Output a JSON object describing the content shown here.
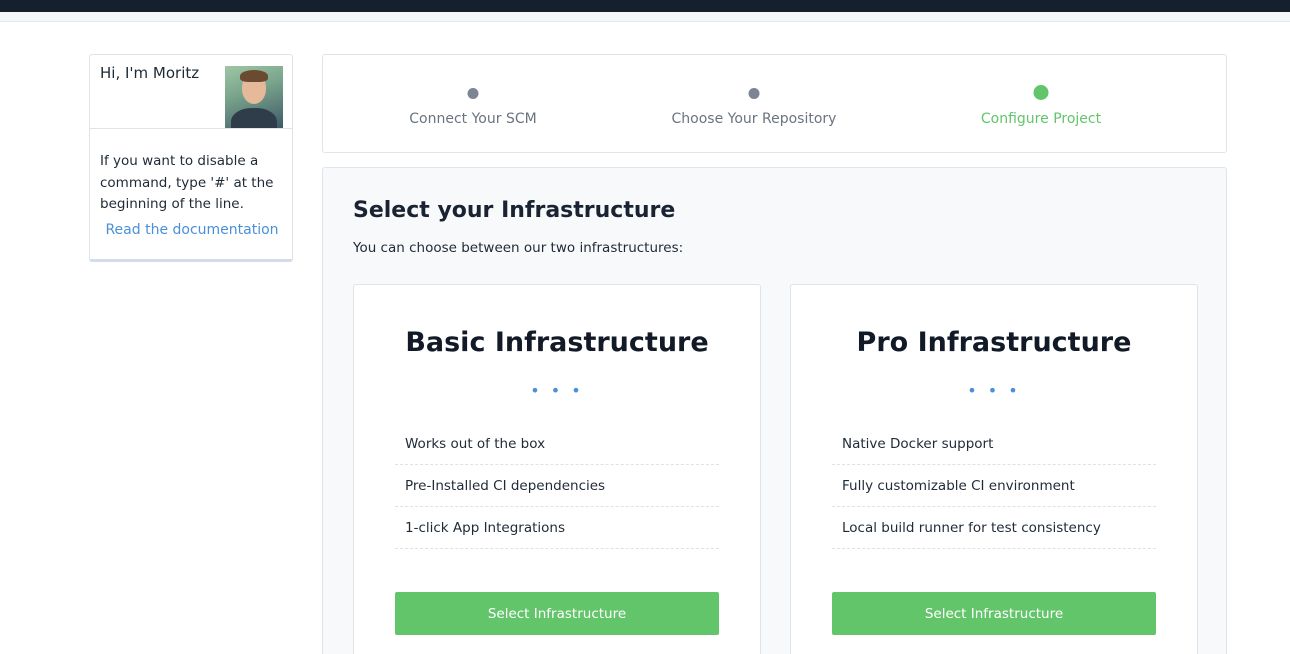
{
  "tip": {
    "greeting": "Hi, I'm Moritz",
    "text": "If you want to disable a command, type '#' at the beginning of the line.",
    "link": "Read the documentation"
  },
  "stepper": {
    "steps": [
      {
        "label": "Connect Your SCM",
        "state": "done"
      },
      {
        "label": "Choose Your Repository",
        "state": "done"
      },
      {
        "label": "Configure Project",
        "state": "active"
      }
    ]
  },
  "main": {
    "title": "Select your Infrastructure",
    "subtitle": "You can choose between our two infrastructures:",
    "cards": [
      {
        "title": "Basic Infrastructure",
        "ellipsis": "• • •",
        "features": [
          "Works out of the box",
          "Pre-Installed CI dependencies",
          "1-click App Integrations"
        ],
        "button": "Select Infrastructure"
      },
      {
        "title": "Pro Infrastructure",
        "ellipsis": "• • •",
        "features": [
          "Native Docker support",
          "Fully customizable CI environment",
          "Local build runner for test consistency"
        ],
        "button": "Select Infrastructure"
      }
    ]
  },
  "colors": {
    "accent_green": "#62c56a",
    "link_blue": "#4a90d9",
    "topbar": "#14202e"
  }
}
